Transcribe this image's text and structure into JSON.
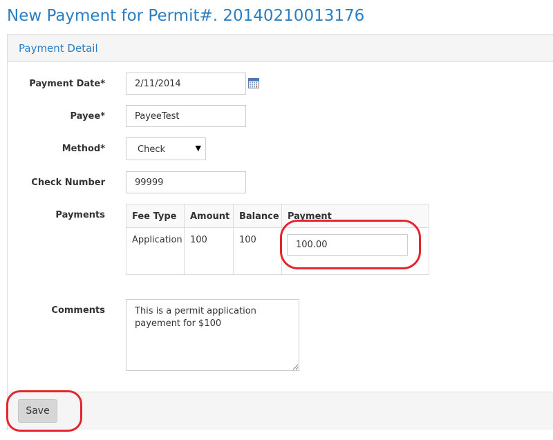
{
  "page": {
    "title": "New Payment for Permit#. 20140210013176"
  },
  "panel": {
    "title": "Payment Detail"
  },
  "form": {
    "payment_date": {
      "label": "Payment Date*",
      "value": "2/11/2014"
    },
    "payee": {
      "label": "Payee*",
      "value": "PayeeTest"
    },
    "method": {
      "label": "Method*",
      "value": "Check"
    },
    "check_number": {
      "label": "Check Number",
      "value": "99999"
    },
    "payments_label": "Payments",
    "comments": {
      "label": "Comments",
      "value": "This is a permit application payement for $100"
    }
  },
  "fees_table": {
    "headers": [
      "Fee Type",
      "Amount",
      "Balance",
      "Payment"
    ],
    "rows": [
      {
        "fee_type": "Application",
        "amount": "100",
        "balance": "100",
        "payment": "100.00"
      }
    ]
  },
  "footer": {
    "save_label": "Save"
  },
  "icons": {
    "calendar": "calendar-icon",
    "dropdown": "caret-down-icon"
  },
  "colors": {
    "title_blue": "#2a7fc4",
    "annotation_red": "#e3262e"
  }
}
